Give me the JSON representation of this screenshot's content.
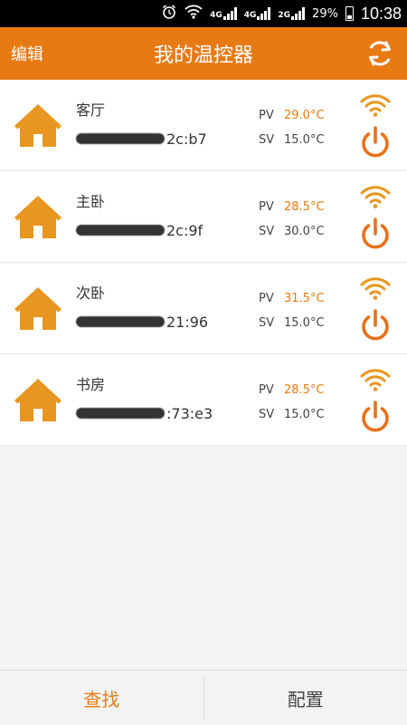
{
  "status_bar": {
    "net1": "4G",
    "net2": "4G",
    "net3": "2G",
    "battery": "29%",
    "time": "10:38"
  },
  "header": {
    "edit_label": "编辑",
    "title": "我的温控器",
    "accent_color": "#e87a14"
  },
  "devices": [
    {
      "name": "客厅",
      "mac_visible": "2c:b7",
      "pv_label": "PV",
      "pv": "29.0°C",
      "sv_label": "SV",
      "sv": "15.0°C"
    },
    {
      "name": "主卧",
      "mac_visible": "2c:9f",
      "pv_label": "PV",
      "pv": "28.5°C",
      "sv_label": "SV",
      "sv": "30.0°C"
    },
    {
      "name": "次卧",
      "mac_visible": "21:96",
      "pv_label": "PV",
      "pv": "31.5°C",
      "sv_label": "SV",
      "sv": "15.0°C"
    },
    {
      "name": "书房",
      "mac_visible": ":73:e3",
      "pv_label": "PV",
      "pv": "28.5°C",
      "sv_label": "SV",
      "sv": "15.0°C"
    }
  ],
  "bottom_bar": {
    "find_label": "查找",
    "config_label": "配置"
  }
}
